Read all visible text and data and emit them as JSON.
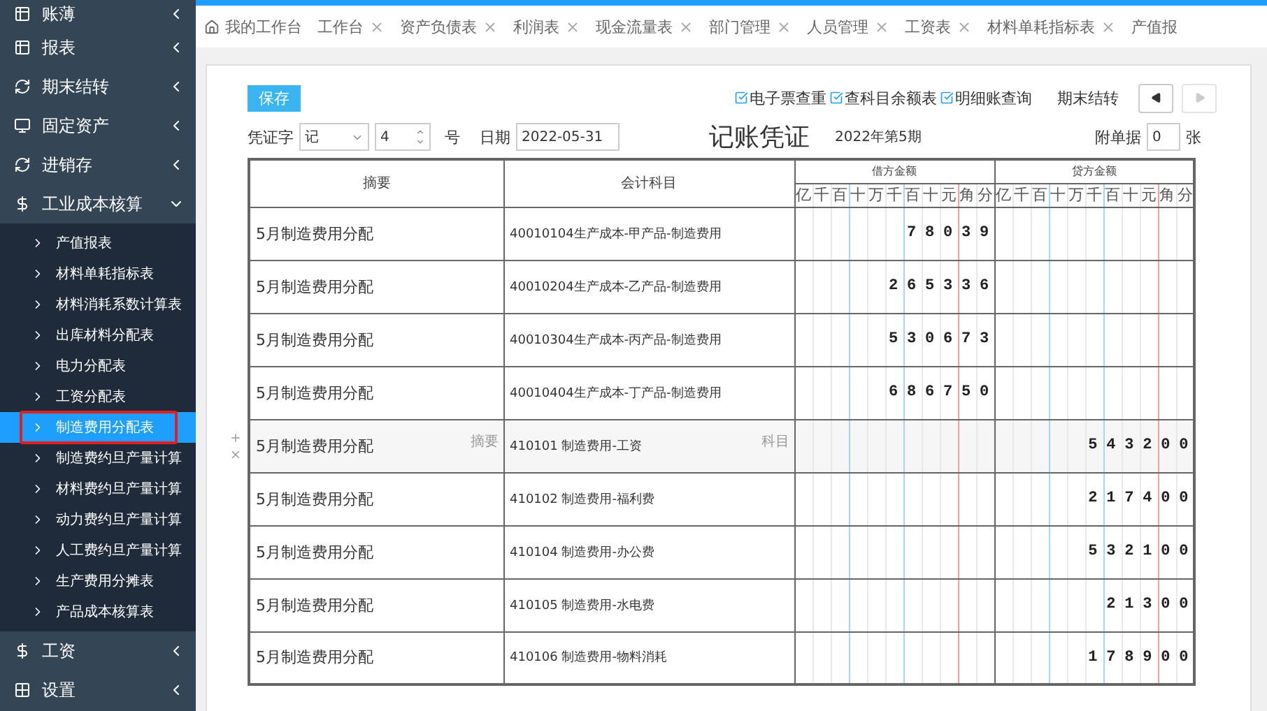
{
  "sidebar": {
    "items": [
      {
        "label": "账薄",
        "expanded": false
      },
      {
        "label": "报表",
        "expanded": false
      },
      {
        "label": "期末结转",
        "expanded": false
      },
      {
        "label": "固定资产",
        "expanded": false
      },
      {
        "label": "进销存",
        "expanded": false
      },
      {
        "label": "工业成本核算",
        "expanded": true,
        "children": [
          {
            "label": "产值报表",
            "selected": false
          },
          {
            "label": "材料单耗指标表",
            "selected": false
          },
          {
            "label": "材料消耗系数计算表",
            "selected": false
          },
          {
            "label": "出库材料分配表",
            "selected": false
          },
          {
            "label": "电力分配表",
            "selected": false
          },
          {
            "label": "工资分配表",
            "selected": false
          },
          {
            "label": "制造费用分配表",
            "selected": true
          },
          {
            "label": "制造费约旦产量计算",
            "selected": false
          },
          {
            "label": "材料费约旦产量计算",
            "selected": false
          },
          {
            "label": "动力费约旦产量计算",
            "selected": false
          },
          {
            "label": "人工费约旦产量计算",
            "selected": false
          },
          {
            "label": "生产费用分摊表",
            "selected": false
          },
          {
            "label": "产品成本核算表",
            "selected": false
          }
        ]
      },
      {
        "label": "工资",
        "expanded": false
      },
      {
        "label": "设置",
        "expanded": false
      }
    ]
  },
  "tabs": [
    {
      "label": "我的工作台",
      "kind": "home",
      "selected": false
    },
    {
      "label": "工作台",
      "kind": "closable",
      "selected": false
    },
    {
      "label": "资产负债表",
      "kind": "closable",
      "selected": false
    },
    {
      "label": "利润表",
      "kind": "closable",
      "selected": false
    },
    {
      "label": "现金流量表",
      "kind": "closable",
      "selected": false
    },
    {
      "label": "部门管理",
      "kind": "closable",
      "selected": false
    },
    {
      "label": "人员管理",
      "kind": "closable",
      "selected": false
    },
    {
      "label": "工资表",
      "kind": "closable",
      "selected": false
    },
    {
      "label": "材料单耗指标表",
      "kind": "closable",
      "selected": false
    },
    {
      "label": "产值报",
      "kind": "cut",
      "selected": false
    }
  ],
  "toolbar": {
    "save": "保存",
    "links": [
      "电子票查重",
      "查科目余额表",
      "明细账查询"
    ],
    "period_close": "期末结转",
    "prev_disabled": false,
    "next_disabled": true
  },
  "voucher": {
    "word_label": "凭证字",
    "word": "记",
    "number": "4",
    "number_suffix": "号",
    "date_label": "日期",
    "date": "2022-05-31",
    "title": "记账凭证",
    "period": "2022年第5期",
    "attachments_label": "附单据",
    "attachments": "0",
    "attachments_suffix": "张"
  },
  "table": {
    "columns": [
      {
        "label": "摘要"
      },
      {
        "label": "会计科目"
      },
      {
        "label": "借方金额",
        "units": [
          "亿",
          "千",
          "百",
          "十",
          "万",
          "千",
          "百",
          "十",
          "元",
          "角",
          "分"
        ]
      },
      {
        "label": "贷方金额",
        "units": [
          "亿",
          "千",
          "百",
          "十",
          "万",
          "千",
          "百",
          "十",
          "元",
          "角",
          "分"
        ]
      }
    ],
    "summary_hint": "摘要",
    "account_hint": "科目",
    "rows": [
      {
        "summary": "5月制造费用分配",
        "account": "40010104生产成本-甲产品-制造费用",
        "debit": "78039",
        "credit": "",
        "active": false
      },
      {
        "summary": "5月制造费用分配",
        "account": "40010204生产成本-乙产品-制造费用",
        "debit": "265336",
        "credit": "",
        "active": false
      },
      {
        "summary": "5月制造费用分配",
        "account": "40010304生产成本-丙产品-制造费用",
        "debit": "530673",
        "credit": "",
        "active": false
      },
      {
        "summary": "5月制造费用分配",
        "account": "40010404生产成本-丁产品-制造费用",
        "debit": "686750",
        "credit": "",
        "active": false
      },
      {
        "summary": "5月制造费用分配",
        "account": "410101 制造费用-工资",
        "debit": "",
        "credit": "543200",
        "active": true
      },
      {
        "summary": "5月制造费用分配",
        "account": "410102 制造费用-福利费",
        "debit": "",
        "credit": "217400",
        "active": false
      },
      {
        "summary": "5月制造费用分配",
        "account": "410104 制造费用-办公费",
        "debit": "",
        "credit": "532100",
        "active": false
      },
      {
        "summary": "5月制造费用分配",
        "account": "410105 制造费用-水电费",
        "debit": "",
        "credit": "21300",
        "active": false
      },
      {
        "summary": "5月制造费用分配",
        "account": "410106 制造费用-物料消耗",
        "debit": "",
        "credit": "178900",
        "active": false
      }
    ]
  }
}
